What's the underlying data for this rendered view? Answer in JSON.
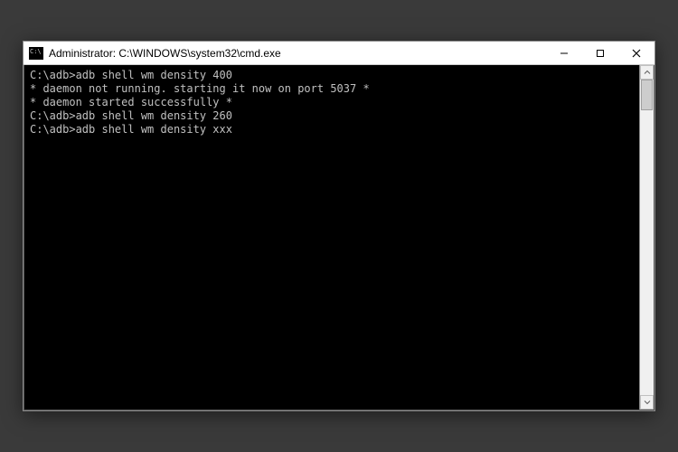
{
  "window": {
    "title": "Administrator: C:\\WINDOWS\\system32\\cmd.exe"
  },
  "console": {
    "lines": [
      {
        "prompt": "C:\\adb>",
        "text": "adb shell wm density 400"
      },
      {
        "prompt": "",
        "text": "* daemon not running. starting it now on port 5037 *"
      },
      {
        "prompt": "",
        "text": "* daemon started successfully *"
      },
      {
        "prompt": "",
        "text": ""
      },
      {
        "prompt": "C:\\adb>",
        "text": "adb shell wm density 260"
      },
      {
        "prompt": "",
        "text": ""
      },
      {
        "prompt": "C:\\adb>",
        "text": "adb shell wm density xxx"
      }
    ]
  }
}
